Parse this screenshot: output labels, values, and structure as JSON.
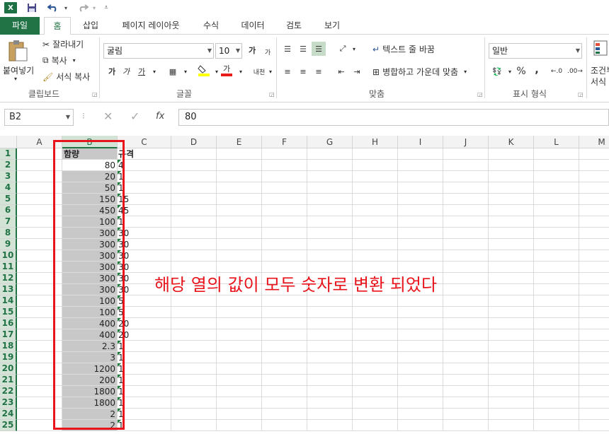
{
  "qat": {
    "logo": "X"
  },
  "tabs": [
    "파일",
    "홈",
    "삽입",
    "페이지 레이아웃",
    "수식",
    "데이터",
    "검토",
    "보기"
  ],
  "ribbon": {
    "clipboard": {
      "paste": "붙여넣기",
      "cut": "잘라내기",
      "copy": "복사",
      "format_painter": "서식 복사",
      "label": "클립보드"
    },
    "font": {
      "name": "굴림",
      "size": "10",
      "label": "글꼴",
      "bold": "가",
      "italic": "가",
      "underline": "가",
      "grow": "가",
      "shrink": "가",
      "phonetic": "내천"
    },
    "alignment": {
      "wrap": "텍스트 줄 바꿈",
      "merge": "병합하고 가운데 맞춤",
      "label": "맞춤"
    },
    "number": {
      "format": "일반",
      "label": "표시 형식",
      "percent": "%",
      "comma": ","
    },
    "styles": {
      "cond": "조건부",
      "cond2": "서식"
    }
  },
  "formula_bar": {
    "name_box": "B2",
    "fx_label": "fx",
    "value": "80"
  },
  "columns": [
    "A",
    "B",
    "C",
    "D",
    "E",
    "F",
    "G",
    "H",
    "I",
    "J",
    "K",
    "L",
    "M"
  ],
  "rows": [
    "1",
    "2",
    "3",
    "4",
    "5",
    "6",
    "7",
    "8",
    "9",
    "10",
    "11",
    "12",
    "13",
    "14",
    "15",
    "16",
    "17",
    "18",
    "19",
    "20",
    "21",
    "22",
    "23",
    "24",
    "25"
  ],
  "b_values": [
    "함량",
    "80",
    "20",
    "50",
    "150",
    "450",
    "100",
    "300",
    "300",
    "300",
    "300",
    "300",
    "300",
    "100",
    "100",
    "400",
    "400",
    "2.3",
    "3",
    "1200",
    "200",
    "1800",
    "1800",
    "2",
    "2"
  ],
  "c_values": [
    "규격",
    "4",
    "1",
    "1",
    "15",
    "45",
    "1",
    "30",
    "30",
    "30",
    "30",
    "30",
    "30",
    "5",
    "5",
    "20",
    "20",
    "1",
    "1",
    "1",
    "1",
    "1",
    "1",
    "1",
    "1"
  ],
  "annotation": "해당 열의 값이 모두 숫자로 변환 되었다"
}
